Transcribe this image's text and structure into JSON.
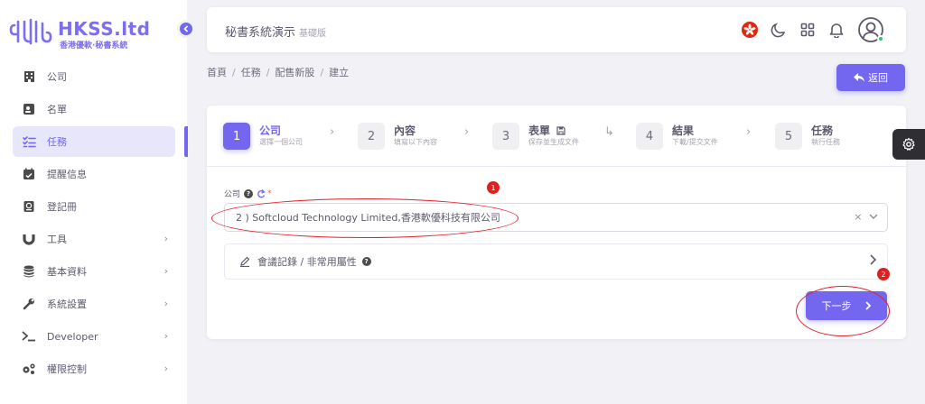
{
  "brand": {
    "name": "HKSS.ltd",
    "tagline": "香港優軟·秘書系統",
    "color": "#7367f0"
  },
  "sidebar": {
    "items": [
      {
        "label": "公司",
        "icon": "building-icon",
        "has_submenu": false,
        "active": false
      },
      {
        "label": "名單",
        "icon": "contact-card-icon",
        "has_submenu": false,
        "active": false
      },
      {
        "label": "任務",
        "icon": "checklist-icon",
        "has_submenu": false,
        "active": true
      },
      {
        "label": "提醒信息",
        "icon": "calendar-check-icon",
        "has_submenu": false,
        "active": false
      },
      {
        "label": "登記冊",
        "icon": "register-book-icon",
        "has_submenu": false,
        "active": false
      },
      {
        "label": "工具",
        "icon": "magnet-icon",
        "has_submenu": true,
        "active": false
      },
      {
        "label": "基本資料",
        "icon": "database-icon",
        "has_submenu": true,
        "active": false
      },
      {
        "label": "系統設置",
        "icon": "wrench-icon",
        "has_submenu": true,
        "active": false
      },
      {
        "label": "Developer",
        "icon": "terminal-icon",
        "has_submenu": true,
        "active": false
      },
      {
        "label": "權限控制",
        "icon": "cogs-icon",
        "has_submenu": true,
        "active": false
      }
    ]
  },
  "navbar": {
    "title": "秘書系統演示",
    "subtitle": "基礎版"
  },
  "breadcrumb": [
    "首頁",
    "任務",
    "配售新股",
    "建立"
  ],
  "back_button": {
    "label": "返回"
  },
  "stepper": [
    {
      "num": "1",
      "title": "公司",
      "desc": "選擇一個公司",
      "active": true
    },
    {
      "num": "2",
      "title": "內容",
      "desc": "填寫以下內容",
      "active": false
    },
    {
      "num": "3",
      "title": "表單",
      "desc": "保存並生成文件",
      "active": false
    },
    {
      "num": "4",
      "title": "結果",
      "desc": "下載/提交文件",
      "active": false
    },
    {
      "num": "5",
      "title": "任務",
      "desc": "執行任務",
      "active": false
    }
  ],
  "form": {
    "company_label": "公司",
    "company_value": "2 ) Softcloud Technology Limited,香港軟優科技有限公司",
    "accordion_label": "會議記錄 / 非常用屬性"
  },
  "next_button": {
    "label": "下一步"
  },
  "annotations": [
    "1",
    "2"
  ]
}
